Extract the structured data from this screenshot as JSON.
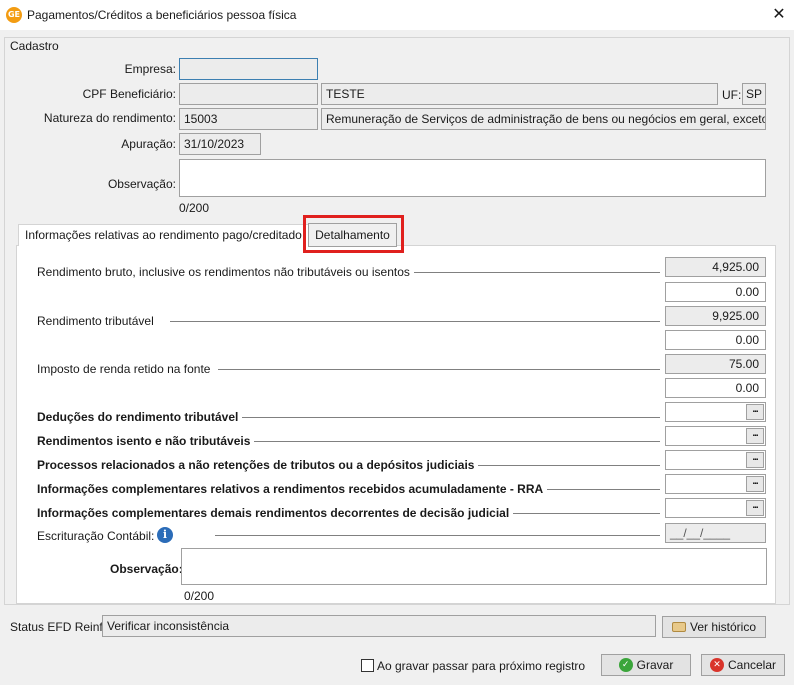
{
  "window": {
    "app_badge": "GE",
    "title": "Pagamentos/Créditos a beneficiários pessoa física",
    "close": "✕"
  },
  "cadastro": {
    "legend": "Cadastro",
    "empresa_label": "Empresa:",
    "empresa_value": "",
    "cpf_label": "CPF Beneficiário:",
    "cpf_value": "",
    "nome_value": "TESTE",
    "uf_label": "UF:",
    "uf_value": "SP",
    "natureza_label": "Natureza do rendimento:",
    "natureza_code": "15003",
    "natureza_desc": "Remuneração de Serviços de administração de bens ou negócios em geral, exceto c",
    "apuracao_label": "Apuração:",
    "apuracao_value": "31/10/2023",
    "observacao_label": "Observação:",
    "observacao_value": "",
    "observacao_count": "0/200"
  },
  "tabs": [
    {
      "label": "Informações relativas ao rendimento pago/creditado",
      "active": true
    },
    {
      "label": "Detalhamento",
      "active": false
    }
  ],
  "detail": {
    "rendimento_bruto_label": "Rendimento bruto, inclusive os rendimentos não tributáveis ou isentos",
    "rendimento_bruto_1": "4,925.00",
    "rendimento_bruto_2": "0.00",
    "rendimento_tributavel_label": "Rendimento tributável",
    "rendimento_tributavel_1": "9,925.00",
    "rendimento_tributavel_2": "0.00",
    "imposto_label": "Imposto de renda retido na fonte",
    "imposto_1": "75.00",
    "imposto_2": "0.00",
    "deducoes_label": "Deduções do rendimento tributável",
    "isentos_label": "Rendimentos isento e não tributáveis",
    "processos_label": "Processos relacionados a não retenções de tributos ou a depósitos judiciais",
    "rra_label": "Informações complementares relativos a rendimentos recebidos acumuladamente - RRA",
    "decisao_label": "Informações complementares demais rendimentos decorrentes de decisão judicial",
    "ellipsis": "...",
    "escrituracao_label": "Escrituração Contábil:",
    "info_glyph": "i",
    "escrituracao_value": "__/__/____",
    "observacao_label": "Observação:",
    "observacao_value": "",
    "observacao_count": "0/200"
  },
  "status": {
    "label": "Status EFD Reinf:",
    "value": "Verificar inconsistência",
    "historico_button": "Ver histórico"
  },
  "footer": {
    "checkbox_label": "Ao gravar passar para próximo registro",
    "checkbox_checked": false,
    "gravar_button": "Gravar",
    "cancelar_button": "Cancelar"
  },
  "colors": {
    "highlight": "#e0201e",
    "gravar_icon": "#3aa53a",
    "cancelar_icon": "#d9342b",
    "info_icon": "#2b6cb8"
  }
}
